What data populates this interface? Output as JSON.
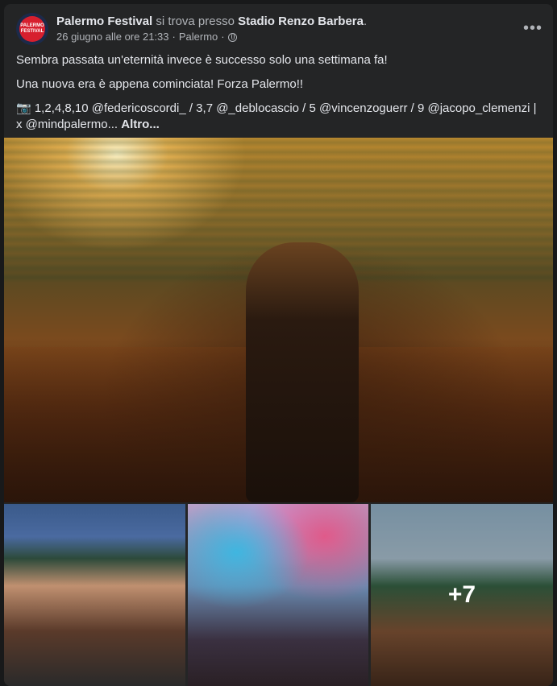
{
  "post": {
    "page_name": "Palermo Festival",
    "connector": "si trova presso",
    "location": "Stadio Renzo Barbera",
    "period": ".",
    "date": "26 giugno alle ore 21:33",
    "separator": "·",
    "place": "Palermo",
    "separator2": "·",
    "avatar_text_1": "PALERMO",
    "avatar_text_2": "FESTIVAL",
    "more_icon": "•••",
    "paragraph_1": "Sembra passata un'eternità invece è successo solo una settimana fa!",
    "paragraph_2": "Una nuova era è appena cominciata! Forza Palermo!!",
    "credits": "📷 1,2,4,8,10 @federicoscordi_ / 3,7 @_deblocascio / 5 @vincenzoguerr / 9 @jacopo_clemenzi | x @mindpalermo...",
    "more_link": "Altro...",
    "extra_photos": "+7"
  },
  "colors": {
    "card_bg": "#242526",
    "page_bg": "#18191a",
    "text_primary": "#e4e6eb",
    "text_secondary": "#b0b3b8",
    "brand_red": "#d71f2e"
  },
  "icons": [
    "more-options-icon",
    "globe-icon",
    "camera-icon"
  ]
}
